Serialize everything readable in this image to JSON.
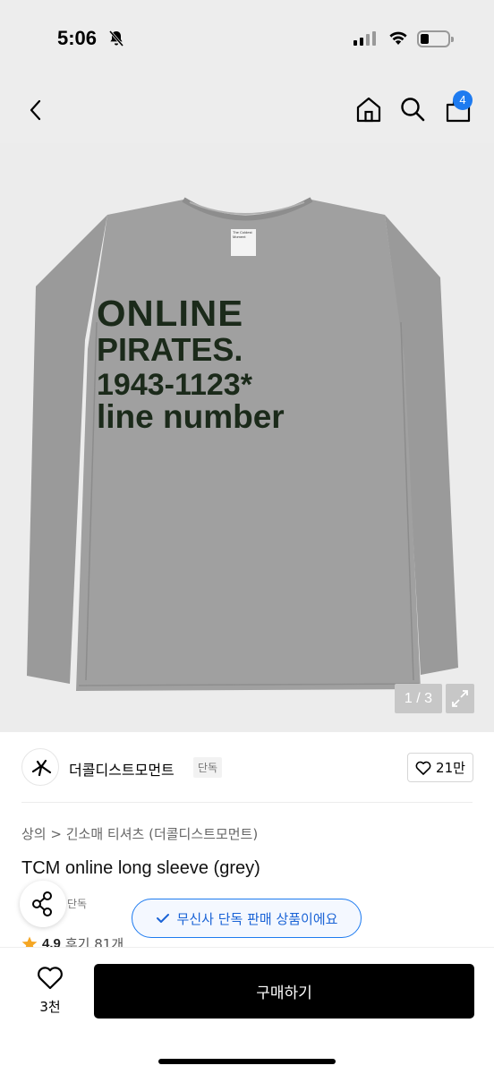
{
  "status_bar": {
    "time": "5:06"
  },
  "nav": {
    "cart_count": "4"
  },
  "hero": {
    "print_line1": "ONLINE",
    "print_line2": "PIRATES.",
    "print_line3": "1943-1123*",
    "print_line4": "line number",
    "image_counter": "1 / 3"
  },
  "brand": {
    "name": "더콜디스트모먼트",
    "tag": "단독",
    "likes": "21만"
  },
  "breadcrumb": {
    "cat1": "상의",
    "sep": ">",
    "cat2": "긴소매 티셔츠",
    "brand": "(더콜디스트모먼트)"
  },
  "product": {
    "title": "TCM online long sleeve (grey)",
    "exclusive_mini": "단독"
  },
  "toast": {
    "text": "무신사 단독 판매 상품이에요"
  },
  "rating": {
    "score": "4.9",
    "reviews": "후기 81개"
  },
  "bottom": {
    "wish_count": "3천",
    "buy_label": "구매하기"
  },
  "colors": {
    "accent": "#1e7bf0",
    "buy_bg": "#000000",
    "rating_star": "#f5a623",
    "hero_bg": "#ececec",
    "shirt": "#9b9b9b"
  }
}
